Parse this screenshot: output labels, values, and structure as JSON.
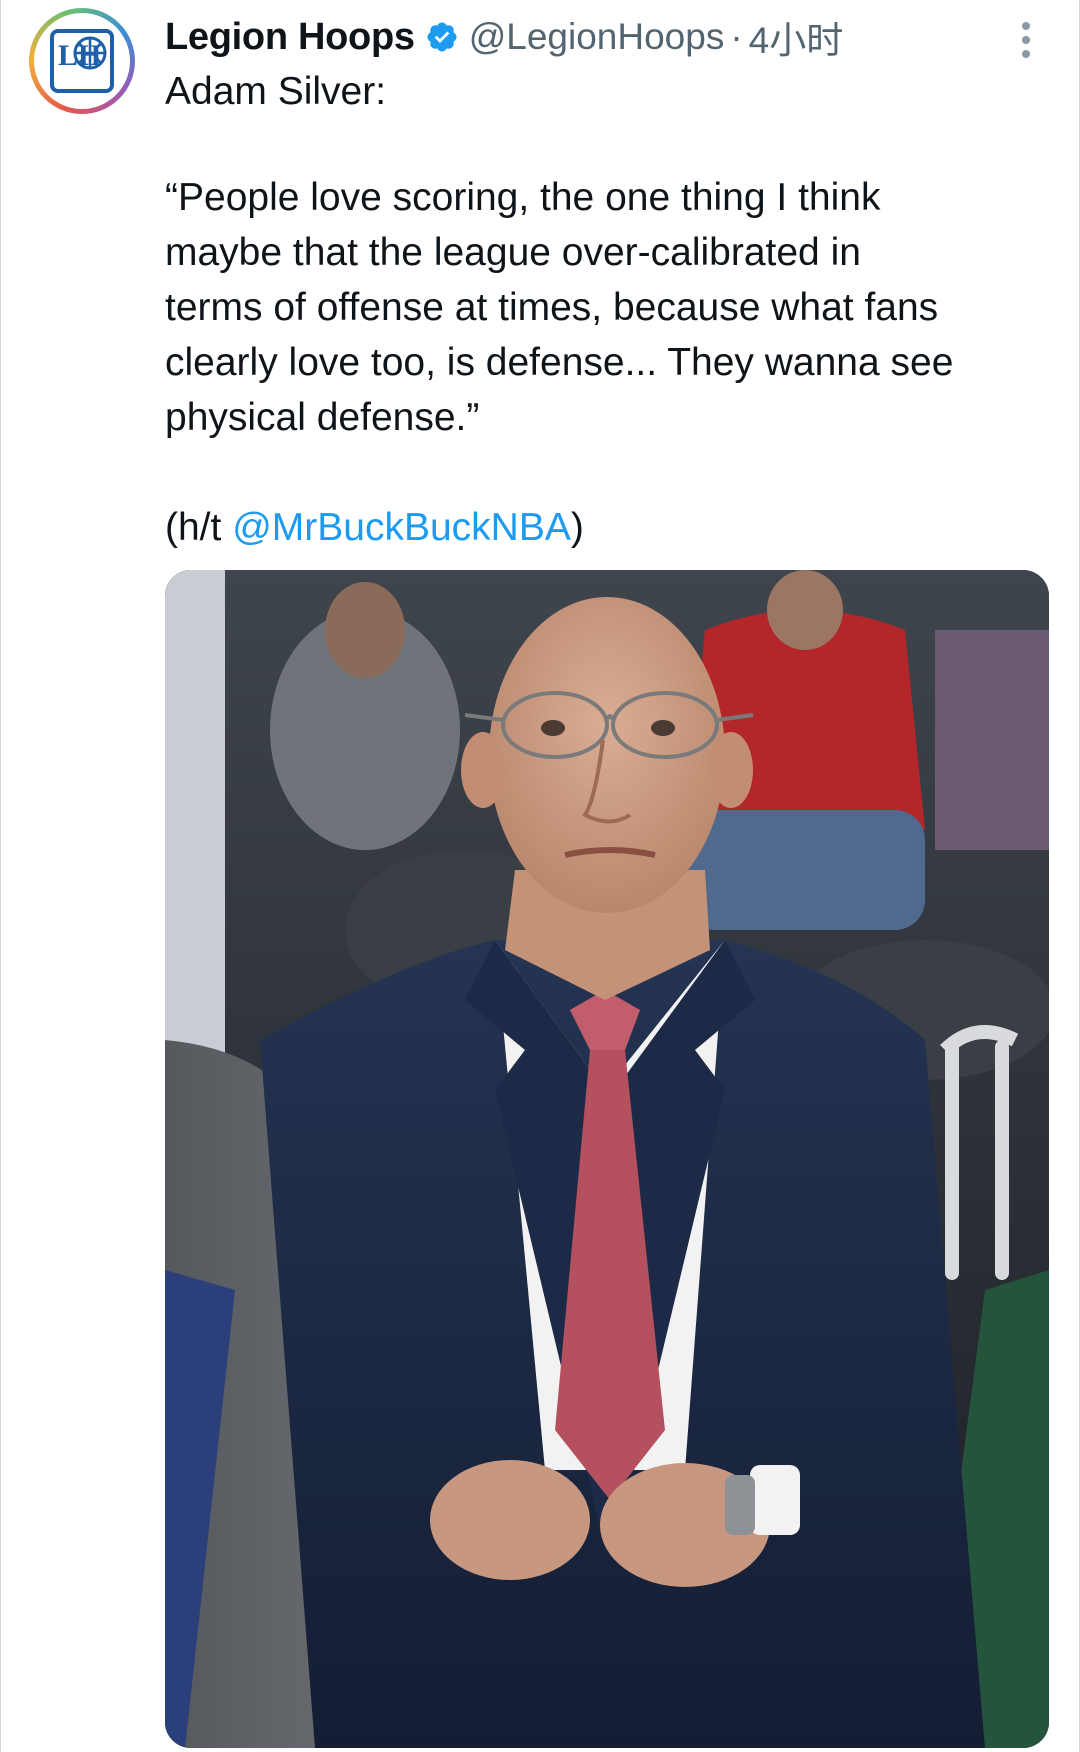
{
  "tweet": {
    "display_name": "Legion Hoops",
    "handle": "@LegionHoops",
    "separator": "·",
    "time": "4小时",
    "speaker": "Adam Silver:",
    "quote_lines": [
      "“People love scoring, the one thing I think",
      "maybe that the league over-calibrated in",
      "terms of offense at times, because what fans",
      "clearly love too, is defense... They wanna see",
      "physical defense.”"
    ],
    "ht_prefix": "(h/t ",
    "ht_mention": "@MrBuckBuckNBA",
    "ht_suffix": ")",
    "avatar_logo": "LH",
    "icons": {
      "verified": "verified-badge-icon",
      "more": "more-options-icon"
    },
    "colors": {
      "link": "#1d9bf0",
      "secondary_text": "#536471",
      "primary_text": "#0f1419"
    }
  }
}
